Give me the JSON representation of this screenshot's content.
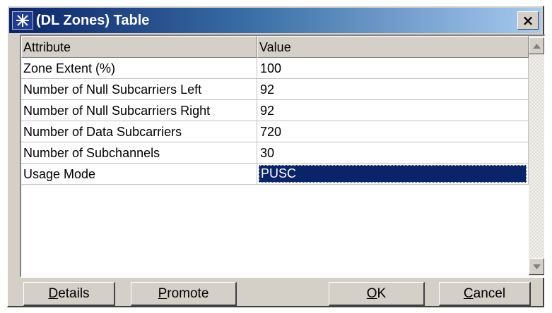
{
  "window": {
    "title": "(DL Zones) Table",
    "close_label": "×"
  },
  "table": {
    "headers": {
      "attribute": "Attribute",
      "value": "Value"
    },
    "rows": [
      {
        "attribute": "Zone Extent (%)",
        "value": "100"
      },
      {
        "attribute": "Number of Null Subcarriers Left",
        "value": "92"
      },
      {
        "attribute": "Number of Null Subcarriers Right",
        "value": "92"
      },
      {
        "attribute": "Number of Data Subcarriers",
        "value": "720"
      },
      {
        "attribute": "Number of Subchannels",
        "value": "30"
      },
      {
        "attribute": "Usage Mode",
        "value": "PUSC"
      }
    ],
    "selected_row": 5
  },
  "buttons": {
    "details": {
      "mnemonic": "D",
      "rest": "etails"
    },
    "promote": {
      "mnemonic": "P",
      "rest": "romote"
    },
    "ok": {
      "mnemonic": "O",
      "rest": "K"
    },
    "cancel": {
      "mnemonic": "C",
      "rest": "ancel"
    }
  },
  "colors": {
    "title_bar_start": "#0a246a",
    "title_bar_end": "#a6caf0",
    "selection": "#0a246a",
    "face": "#d4d0c8"
  }
}
